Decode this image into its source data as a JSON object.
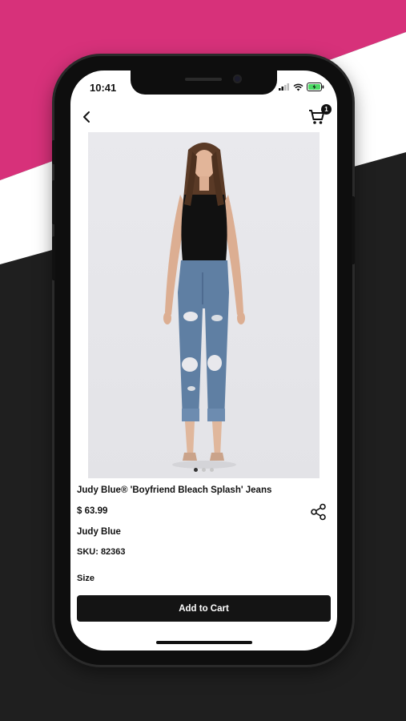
{
  "colors": {
    "accent_pink": "#d7317a",
    "bg_dark": "#1f1f1f",
    "button": "#141414"
  },
  "status_bar": {
    "time": "10:41",
    "icons": [
      "signal-icon",
      "wifi-icon",
      "battery-icon"
    ]
  },
  "header": {
    "back_icon": "chevron-left-icon",
    "cart_icon": "cart-icon",
    "cart_count": "1"
  },
  "product": {
    "image_description": "woman wearing black top and distressed boyfriend jeans",
    "carousel": {
      "count": 3,
      "active_index": 0
    },
    "title": "Judy Blue® 'Boyfriend Bleach Splash' Jeans",
    "price": "$ 63.99",
    "brand": "Judy Blue",
    "sku": "SKU: 82363",
    "size_label": "Size",
    "share_icon": "share-icon"
  },
  "actions": {
    "add_to_cart_label": "Add to Cart"
  }
}
